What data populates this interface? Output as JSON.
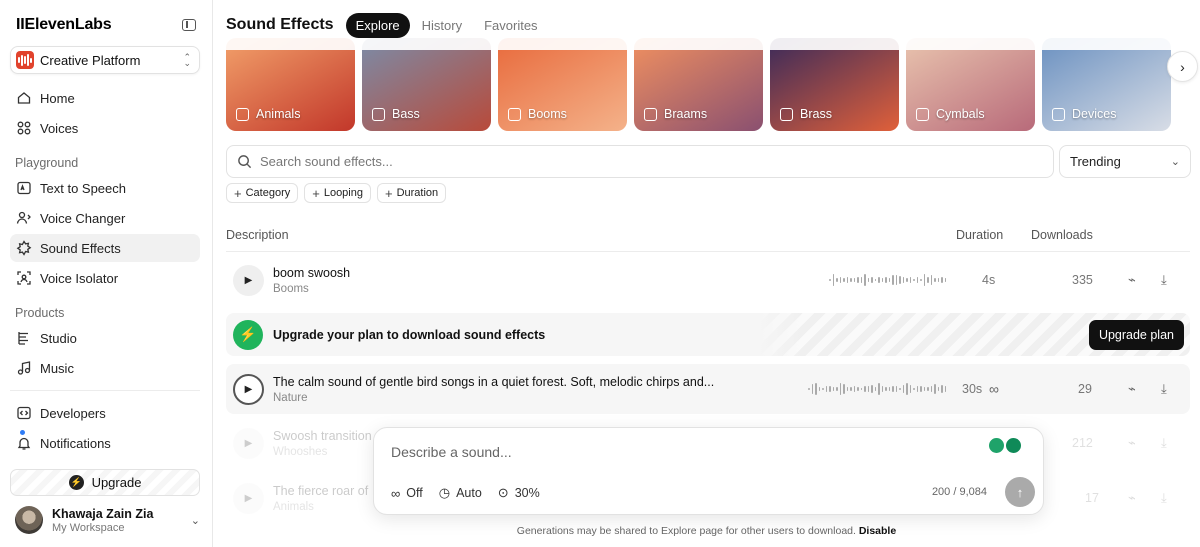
{
  "sidebar": {
    "brand": "IIElevenLabs",
    "workspace": "Creative Platform",
    "top_items": [
      {
        "label": "Home"
      },
      {
        "label": "Voices"
      }
    ],
    "playground_label": "Playground",
    "playground_items": [
      {
        "label": "Text to Speech"
      },
      {
        "label": "Voice Changer"
      },
      {
        "label": "Sound Effects"
      },
      {
        "label": "Voice Isolator"
      }
    ],
    "products_label": "Products",
    "products_items": [
      {
        "label": "Studio"
      },
      {
        "label": "Music"
      }
    ],
    "bottom_items": [
      {
        "label": "Developers"
      },
      {
        "label": "Notifications"
      }
    ],
    "upgrade_label": "Upgrade",
    "user": {
      "name": "Khawaja Zain Zia",
      "workspace": "My Workspace"
    }
  },
  "header": {
    "title": "Sound Effects",
    "tabs": [
      {
        "label": "Explore"
      },
      {
        "label": "History"
      },
      {
        "label": "Favorites"
      }
    ]
  },
  "categories": [
    {
      "label": "Animals",
      "colors": [
        "#f2a06a",
        "#c2372a"
      ]
    },
    {
      "label": "Bass",
      "colors": [
        "#7b8ca8",
        "#b84a3a"
      ]
    },
    {
      "label": "Booms",
      "colors": [
        "#e86a3c",
        "#f4b28a"
      ]
    },
    {
      "label": "Braams",
      "colors": [
        "#f09060",
        "#8a5070"
      ]
    },
    {
      "label": "Brass",
      "colors": [
        "#3a2a5a",
        "#e0603a"
      ]
    },
    {
      "label": "Cymbals",
      "colors": [
        "#e9c4ae",
        "#b86a7a"
      ]
    },
    {
      "label": "Devices",
      "colors": [
        "#6a90c0",
        "#d8dde6"
      ]
    }
  ],
  "search": {
    "placeholder": "Search sound effects...",
    "sort": "Trending"
  },
  "filters": [
    {
      "label": "Category"
    },
    {
      "label": "Looping"
    },
    {
      "label": "Duration"
    }
  ],
  "table": {
    "headers": {
      "description": "Description",
      "duration": "Duration",
      "downloads": "Downloads"
    },
    "rows": [
      {
        "title": "boom swoosh",
        "category": "Booms",
        "duration": "4s",
        "downloads": "335"
      },
      {
        "title": "The calm sound of gentle bird songs in a quiet forest. Soft, melodic chirps and...",
        "category": "Nature",
        "duration": "30s",
        "downloads": "29"
      },
      {
        "title": "Swoosh transition",
        "category": "Whooshes",
        "duration": "",
        "downloads": "212"
      },
      {
        "title": "The fierce roar of",
        "category": "Animals",
        "duration": "",
        "downloads": "17"
      }
    ]
  },
  "banner": {
    "text": "Upgrade your plan to download sound effects",
    "button": "Upgrade plan"
  },
  "composer": {
    "placeholder": "Describe a sound...",
    "loop": "Off",
    "duration": "Auto",
    "influence": "30%",
    "count": "200 / 9,084"
  },
  "footer": {
    "text": "Generations may be shared to Explore page for other users to download.",
    "link": "Disable"
  },
  "colors": {
    "accent": "#111111",
    "success": "#20b45c",
    "brand_red": "#e1432d"
  }
}
